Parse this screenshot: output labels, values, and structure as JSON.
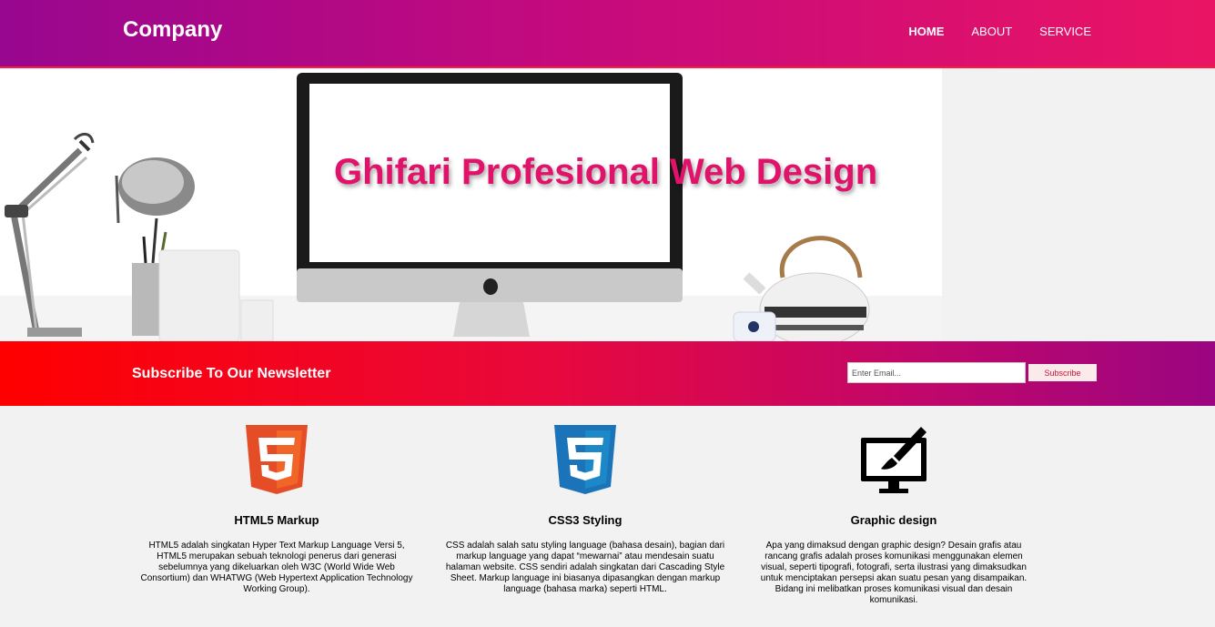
{
  "header": {
    "logo": "Company",
    "nav": [
      {
        "label": "HOME"
      },
      {
        "label": "ABOUT"
      },
      {
        "label": "SERVICE"
      }
    ],
    "colors": {
      "gradient_start": "#98078f",
      "gradient_end": "#ea1464"
    }
  },
  "banner": {
    "title": "Ghifari Profesional Web Design",
    "title_color": "#e0126a"
  },
  "newsletter": {
    "title": "Subscribe To Our Newsletter",
    "email_placeholder": "Enter Email...",
    "button_label": "Subscribe"
  },
  "features": [
    {
      "icon": "html5-icon",
      "title": "HTML5 Markup",
      "text": "HTML5 adalah singkatan Hyper Text Markup Language Versi 5, HTML5 merupakan sebuah teknologi penerus dari generasi sebelumnya yang dikeluarkan oleh W3C (World Wide Web Consortium) dan WHATWG (Web Hypertext Application Technology Working Group)."
    },
    {
      "icon": "css3-icon",
      "title": "CSS3 Styling",
      "text": "CSS adalah salah satu styling language (bahasa desain), bagian dari markup language yang dapat “mewarnai” atau mendesain suatu halaman website. CSS sendiri adalah singkatan dari Cascading Style Sheet. Markup language ini biasanya dipasangkan dengan markup language (bahasa marka) seperti HTML."
    },
    {
      "icon": "graphic-design-icon",
      "title": "Graphic design",
      "text": "Apa yang dimaksud dengan graphic design? Desain grafis atau rancang grafis adalah proses komunikasi menggunakan elemen visual, seperti tipografi, fotografi, serta ilustrasi yang dimaksudkan untuk menciptakan persepsi akan suatu pesan yang disampaikan. Bidang ini melibatkan proses komunikasi visual dan desain komunikasi."
    }
  ]
}
